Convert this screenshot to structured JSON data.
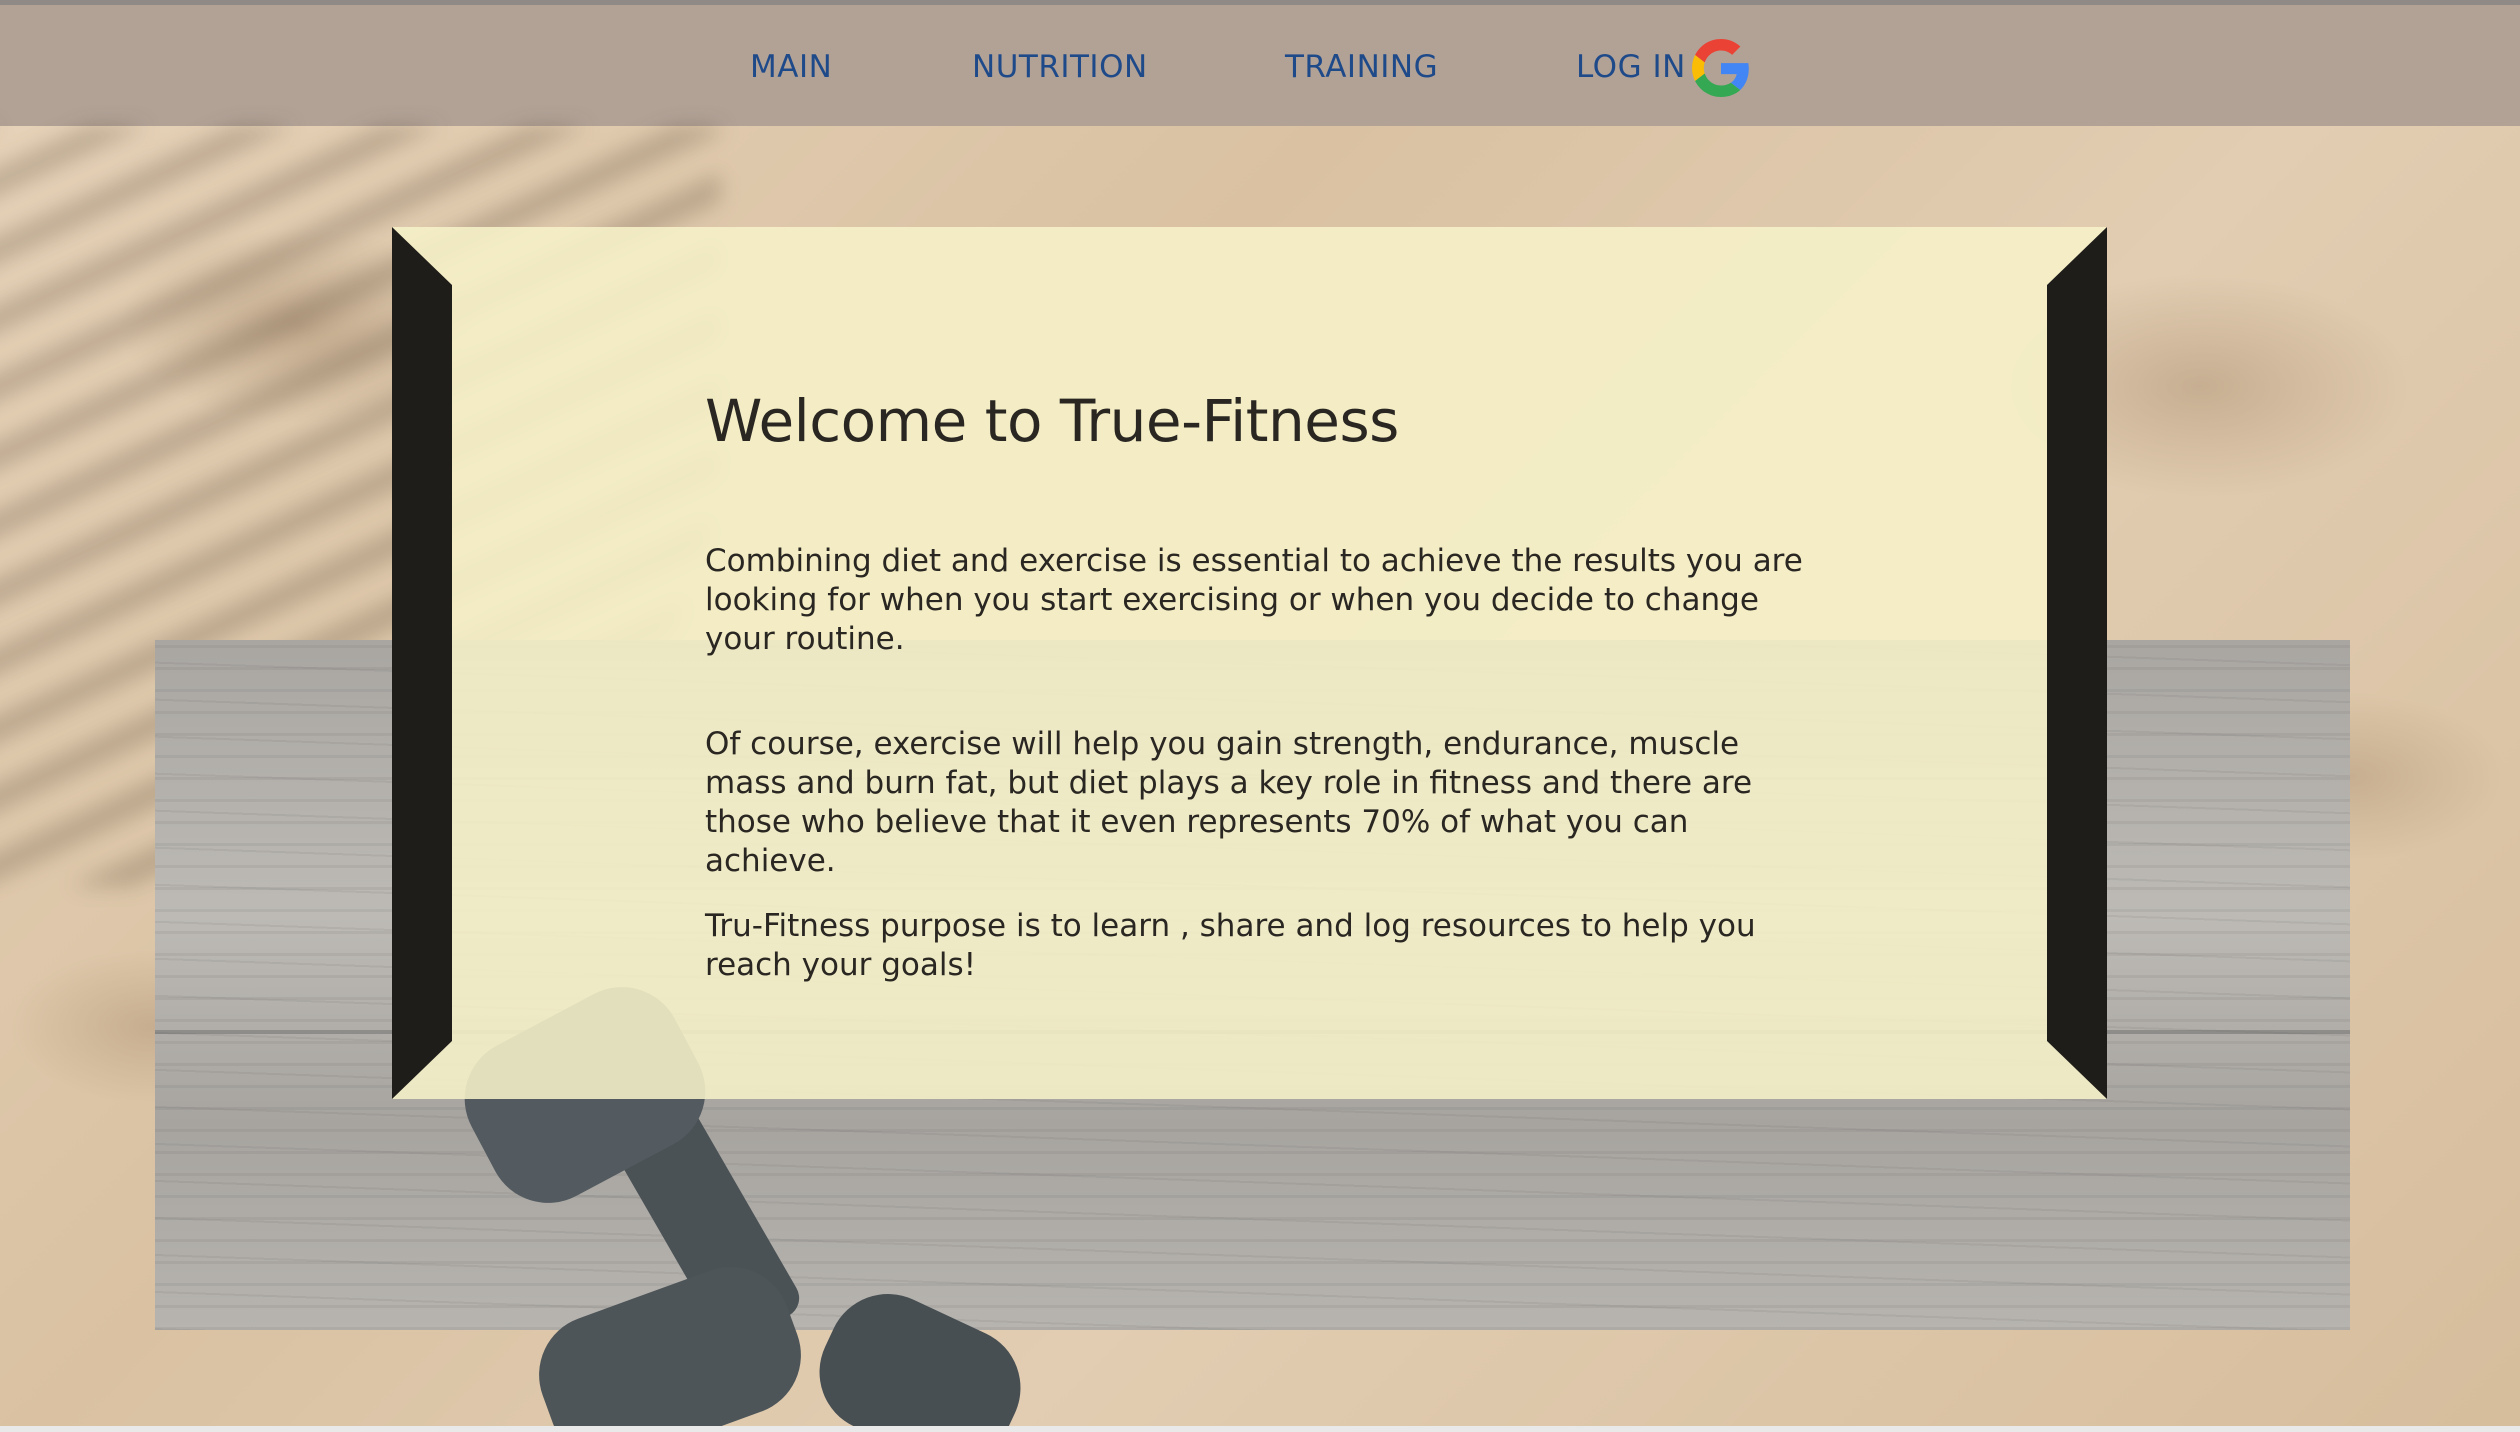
{
  "nav": {
    "main_label": "MAIN",
    "nutrition_label": "NUTRITION",
    "training_label": "TRAINING",
    "login_label": "LOG IN",
    "login_icon": "google-icon"
  },
  "hero": {
    "title": "Welcome to True-Fitness",
    "paragraphs": [
      "Combining diet and exercise is essential to achieve the results you are looking for when you start exercising or when you decide to change your routine.",
      "Of course, exercise will help you gain strength, endurance, muscle mass and burn fat, but diet plays a key role in fitness and there are those who believe that it even represents 70% of what you can achieve.",
      "Tru-Fitness purpose is to learn , share and log resources to help you reach your goals!"
    ]
  },
  "colors": {
    "nav_background": "#b2a296",
    "nav_text": "#1f4a8a",
    "card_background": "#f6f1c8",
    "bevel": "#1f1d1a",
    "text": "#2a2723"
  }
}
